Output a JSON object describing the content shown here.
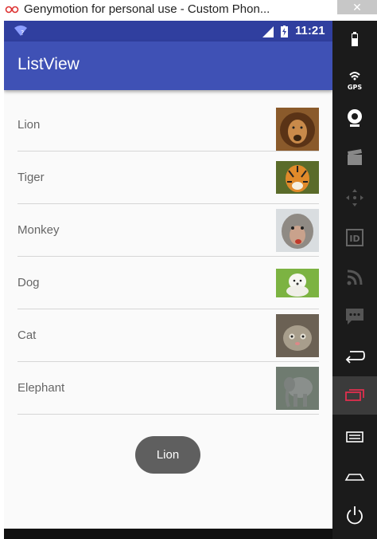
{
  "window": {
    "title": "Genymotion for personal use - Custom Phon...",
    "close_glyph": "✕"
  },
  "status_bar": {
    "time": "11:21",
    "icons": [
      "wifi-icon",
      "signal-icon",
      "battery-charging-icon"
    ]
  },
  "toolbar": {
    "title": "ListView"
  },
  "list": {
    "items": [
      {
        "label": "Lion",
        "image": "lion-thumbnail"
      },
      {
        "label": "Tiger",
        "image": "tiger-thumbnail"
      },
      {
        "label": "Monkey",
        "image": "monkey-thumbnail"
      },
      {
        "label": "Dog",
        "image": "dog-thumbnail"
      },
      {
        "label": "Cat",
        "image": "cat-thumbnail"
      },
      {
        "label": "Elephant",
        "image": "elephant-thumbnail"
      }
    ]
  },
  "toast": {
    "text": "Lion"
  },
  "sidebar": {
    "gps_label": "GPS",
    "id_label": "ID",
    "tools": [
      "battery-icon",
      "gps-icon",
      "camera-icon",
      "capture-icon",
      "dpad-icon",
      "id-icon",
      "rss-icon",
      "sms-icon",
      "back-icon",
      "recents-icon",
      "menu-icon",
      "home-icon",
      "power-icon"
    ]
  },
  "colors": {
    "status_bar": "#303f9f",
    "toolbar": "#3f51b5",
    "toast": "#5f5f5f",
    "sidebar": "#1b1b1b",
    "recents_accent": "#e0304f"
  }
}
